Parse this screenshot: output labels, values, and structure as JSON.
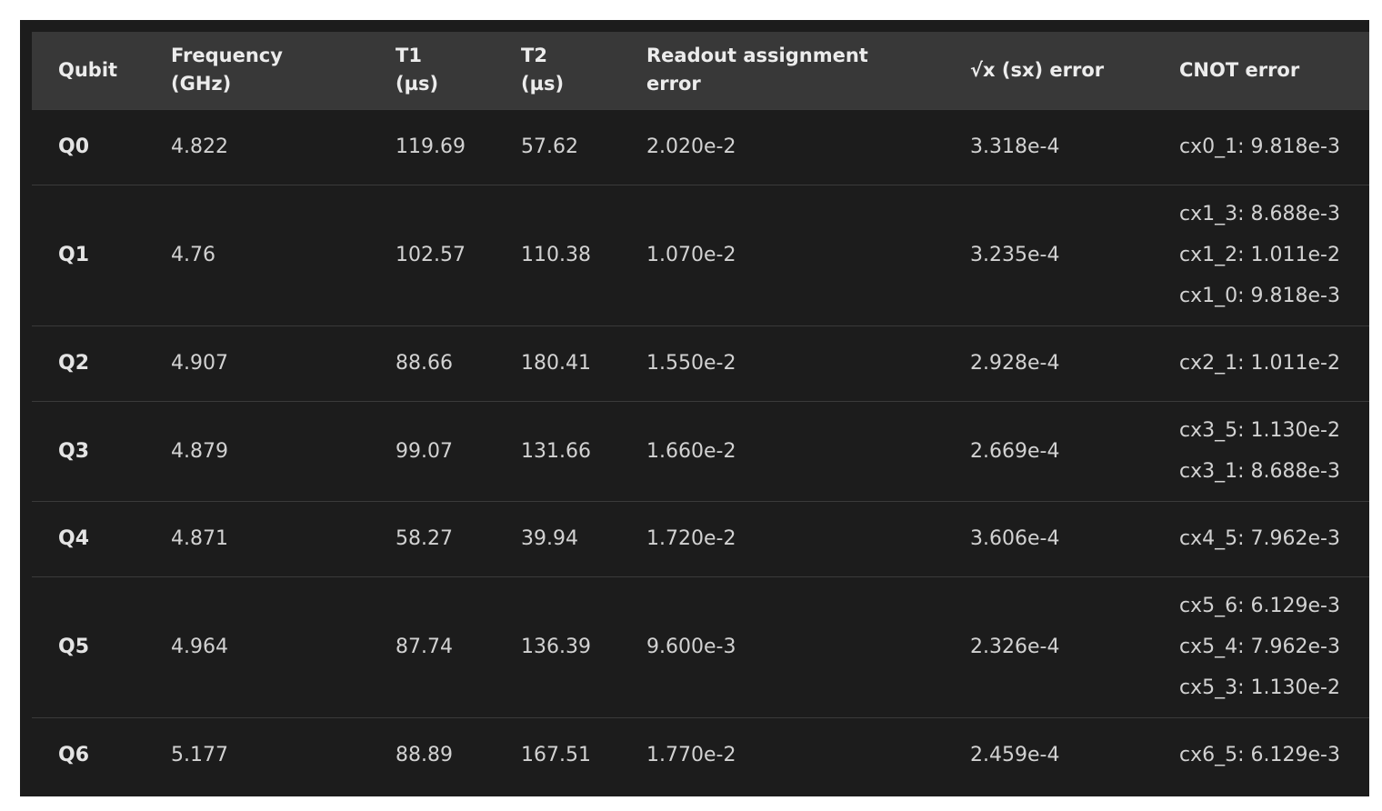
{
  "table": {
    "headers": {
      "qubit": "Qubit",
      "frequency": "Frequency (GHz)",
      "t1": "T1 (µs)",
      "t2": "T2 (µs)",
      "readout": "Readout assignment error",
      "sx": "√x (sx) error",
      "cnot": "CNOT error"
    },
    "rows": [
      {
        "qubit": "Q0",
        "frequency": "4.822",
        "t1": "119.69",
        "t2": "57.62",
        "readout": "2.020e-2",
        "sx": "3.318e-4",
        "cnot": [
          "cx0_1: 9.818e-3"
        ]
      },
      {
        "qubit": "Q1",
        "frequency": "4.76",
        "t1": "102.57",
        "t2": "110.38",
        "readout": "1.070e-2",
        "sx": "3.235e-4",
        "cnot": [
          "cx1_3: 8.688e-3",
          "cx1_2: 1.011e-2",
          "cx1_0: 9.818e-3"
        ]
      },
      {
        "qubit": "Q2",
        "frequency": "4.907",
        "t1": "88.66",
        "t2": "180.41",
        "readout": "1.550e-2",
        "sx": "2.928e-4",
        "cnot": [
          "cx2_1: 1.011e-2"
        ]
      },
      {
        "qubit": "Q3",
        "frequency": "4.879",
        "t1": "99.07",
        "t2": "131.66",
        "readout": "1.660e-2",
        "sx": "2.669e-4",
        "cnot": [
          "cx3_5: 1.130e-2",
          "cx3_1: 8.688e-3"
        ]
      },
      {
        "qubit": "Q4",
        "frequency": "4.871",
        "t1": "58.27",
        "t2": "39.94",
        "readout": "1.720e-2",
        "sx": "3.606e-4",
        "cnot": [
          "cx4_5: 7.962e-3"
        ]
      },
      {
        "qubit": "Q5",
        "frequency": "4.964",
        "t1": "87.74",
        "t2": "136.39",
        "readout": "9.600e-3",
        "sx": "2.326e-4",
        "cnot": [
          "cx5_6: 6.129e-3",
          "cx5_4: 7.962e-3",
          "cx5_3: 1.130e-2"
        ]
      },
      {
        "qubit": "Q6",
        "frequency": "5.177",
        "t1": "88.89",
        "t2": "167.51",
        "readout": "1.770e-2",
        "sx": "2.459e-4",
        "cnot": [
          "cx6_5: 6.129e-3"
        ]
      }
    ]
  }
}
